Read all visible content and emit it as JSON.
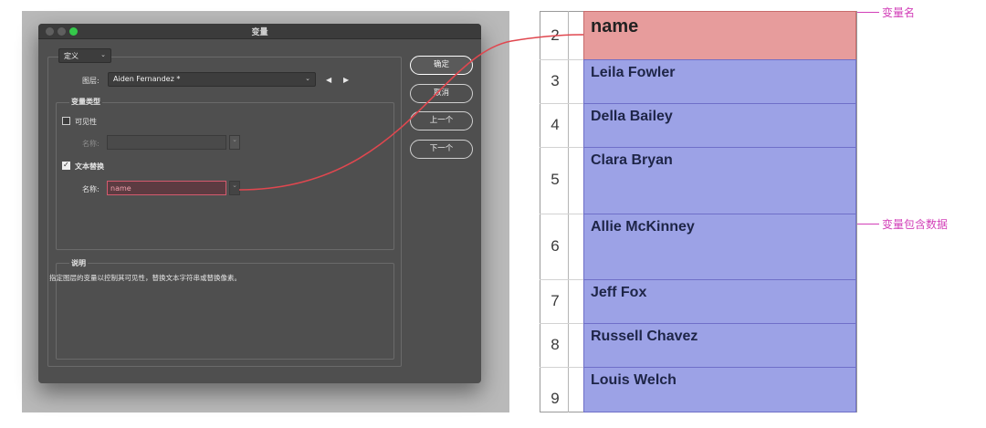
{
  "dialog": {
    "title": "变量",
    "define_select": "定义",
    "layer_label": "图层:",
    "layer_value": "Aiden Fernandez *",
    "var_type_label": "变量类型",
    "visibility_label": "可见性",
    "name_label_disabled": "名称:",
    "text_replace_label": "文本替换",
    "name_label": "名称:",
    "name_value": "name",
    "desc_label": "说明",
    "desc_text": "指定图层的变量以控制其可见性，替换文本字符串或替换像素。",
    "buttons": {
      "ok": "确定",
      "cancel": "取消",
      "prev": "上一个",
      "next": "下一个"
    }
  },
  "sheet": {
    "rows": [
      {
        "num": "2",
        "value": "name"
      },
      {
        "num": "3",
        "value": "Leila Fowler"
      },
      {
        "num": "4",
        "value": "Della Bailey"
      },
      {
        "num": "5",
        "value": "Clara Bryan"
      },
      {
        "num": "6",
        "value": "Allie McKinney"
      },
      {
        "num": "7",
        "value": "Jeff Fox"
      },
      {
        "num": "8",
        "value": "Russell Chavez"
      },
      {
        "num": "9",
        "value": "Louis Welch"
      }
    ]
  },
  "annotations": {
    "var_name": "变量名",
    "var_data": "变量包含数据"
  },
  "colors": {
    "header_fill": "#e79c9c",
    "data_fill": "#9ca2e6",
    "connector": "#e0474f",
    "annotation": "#d23fb8"
  }
}
